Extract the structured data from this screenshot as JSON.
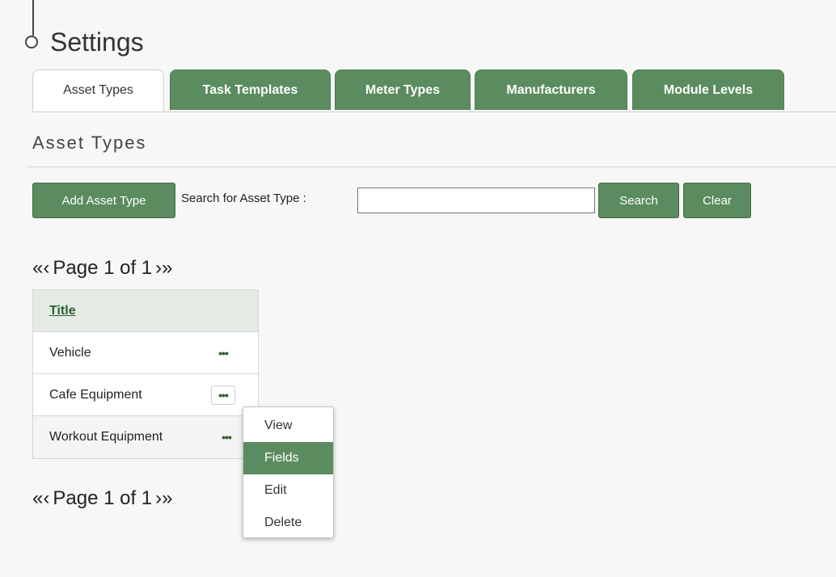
{
  "page": {
    "title": "Settings"
  },
  "tabs": [
    {
      "label": "Asset Types",
      "active": true
    },
    {
      "label": "Task Templates",
      "active": false
    },
    {
      "label": "Meter Types",
      "active": false
    },
    {
      "label": "Manufacturers",
      "active": false
    },
    {
      "label": "Module Levels",
      "active": false
    }
  ],
  "section": {
    "title": "Asset Types"
  },
  "toolbar": {
    "add_label": "Add Asset Type",
    "search_label": "Search for Asset Type :",
    "search_value": "",
    "search_button": "Search",
    "clear_button": "Clear"
  },
  "pager": {
    "first": "«",
    "prev": "‹",
    "text": "Page 1 of 1",
    "next": "›",
    "last": "»"
  },
  "table": {
    "header": "Title",
    "rows": [
      {
        "title": "Vehicle",
        "actions": "•••"
      },
      {
        "title": "Cafe Equipment",
        "actions": "•••"
      },
      {
        "title": "Workout Equipment",
        "actions": "•••"
      }
    ]
  },
  "context_menu": {
    "items": [
      {
        "label": "View",
        "selected": false
      },
      {
        "label": "Fields",
        "selected": true
      },
      {
        "label": "Edit",
        "selected": false
      },
      {
        "label": "Delete",
        "selected": false
      }
    ]
  },
  "colors": {
    "accent": "#5b8c5f",
    "accent_dark": "#3f6c43",
    "header_bg": "#e4ebe4",
    "link": "#2e5e33"
  }
}
